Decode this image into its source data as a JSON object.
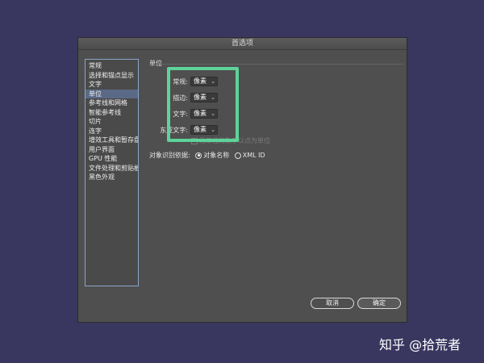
{
  "dialog": {
    "title": "首选项"
  },
  "sidebar": {
    "items": [
      {
        "label": "常规"
      },
      {
        "label": "选择和锚点显示"
      },
      {
        "label": "文字"
      },
      {
        "label": "单位",
        "active": true
      },
      {
        "label": "参考线和网格"
      },
      {
        "label": "智能参考线"
      },
      {
        "label": "切片"
      },
      {
        "label": "连字"
      },
      {
        "label": "增效工具和暂存盘"
      },
      {
        "label": "用户界面"
      },
      {
        "label": "GPU 性能"
      },
      {
        "label": "文件处理和剪贴板"
      },
      {
        "label": "黑色外观"
      }
    ]
  },
  "units": {
    "section_title": "单位",
    "rows": [
      {
        "label": "常规:",
        "value": "像素"
      },
      {
        "label": "描边:",
        "value": "像素"
      },
      {
        "label": "文字:",
        "value": "像素"
      },
      {
        "label": "东亚文字:",
        "value": "像素"
      }
    ],
    "disabled_option": "无单位的数字以点为单位"
  },
  "identify": {
    "label": "对象识别依据:",
    "options": [
      {
        "label": "对象名称",
        "selected": true
      },
      {
        "label": "XML ID",
        "selected": false
      }
    ]
  },
  "buttons": {
    "cancel": "取消",
    "ok": "确定"
  },
  "watermark": "知乎 @拾荒者",
  "colors": {
    "highlight": "#5ed39a",
    "background": "#39365f",
    "panel": "#4f4f4f"
  }
}
